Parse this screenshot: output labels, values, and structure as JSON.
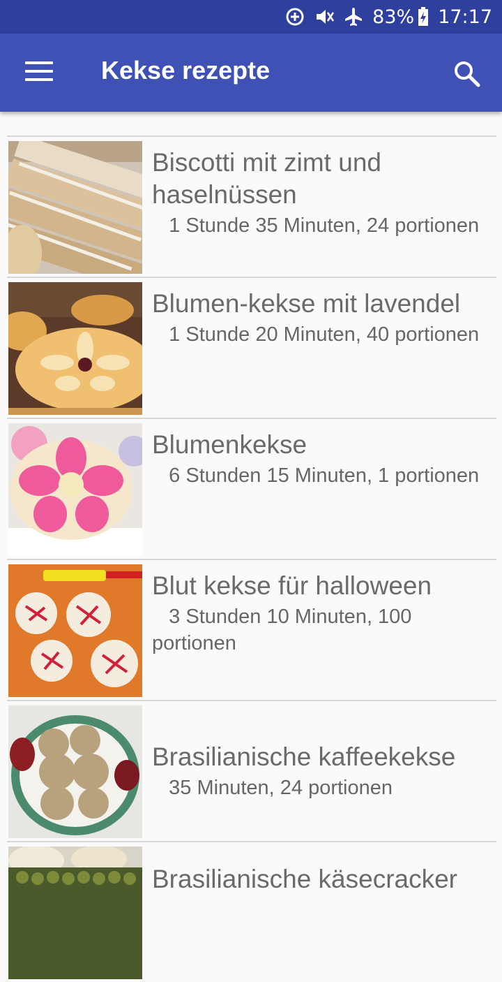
{
  "status_bar": {
    "battery": "83%",
    "time": "17:17"
  },
  "app_bar": {
    "title": "Kekse rezepte"
  },
  "recipes": [
    {
      "title": "Biscotti mit zimt und haselnüssen",
      "details": "   1 Stunde 35 Minuten, 24 portionen"
    },
    {
      "title": "Blumen-kekse mit lavendel",
      "details": "   1 Stunde 20 Minuten, 40 portionen"
    },
    {
      "title": "Blumenkekse",
      "details": "   6 Stunden 15 Minuten, 1 portionen"
    },
    {
      "title": "Blut kekse für halloween",
      "details": "   3 Stunden 10 Minuten, 100 portionen"
    },
    {
      "title": "Brasilianische kaffeekekse",
      "details": "   35 Minuten, 24 portionen"
    },
    {
      "title": "Brasilianische käsecracker",
      "details": ""
    }
  ]
}
